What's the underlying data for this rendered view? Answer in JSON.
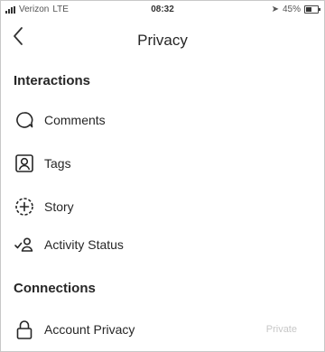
{
  "status_bar": {
    "carrier": "Verizon",
    "network": "LTE",
    "time": "08:32",
    "battery": "45%"
  },
  "nav": {
    "back_icon": "chevron-left-icon",
    "title": "Privacy"
  },
  "sections": {
    "interactions": "Interactions",
    "connections": "Connections"
  },
  "interactions": {
    "comments": "Comments",
    "tags": "Tags",
    "story": "Story",
    "activity_status": "Activity Status"
  },
  "connections": {
    "account_privacy": "Account Privacy",
    "account_privacy_value": "Private"
  }
}
